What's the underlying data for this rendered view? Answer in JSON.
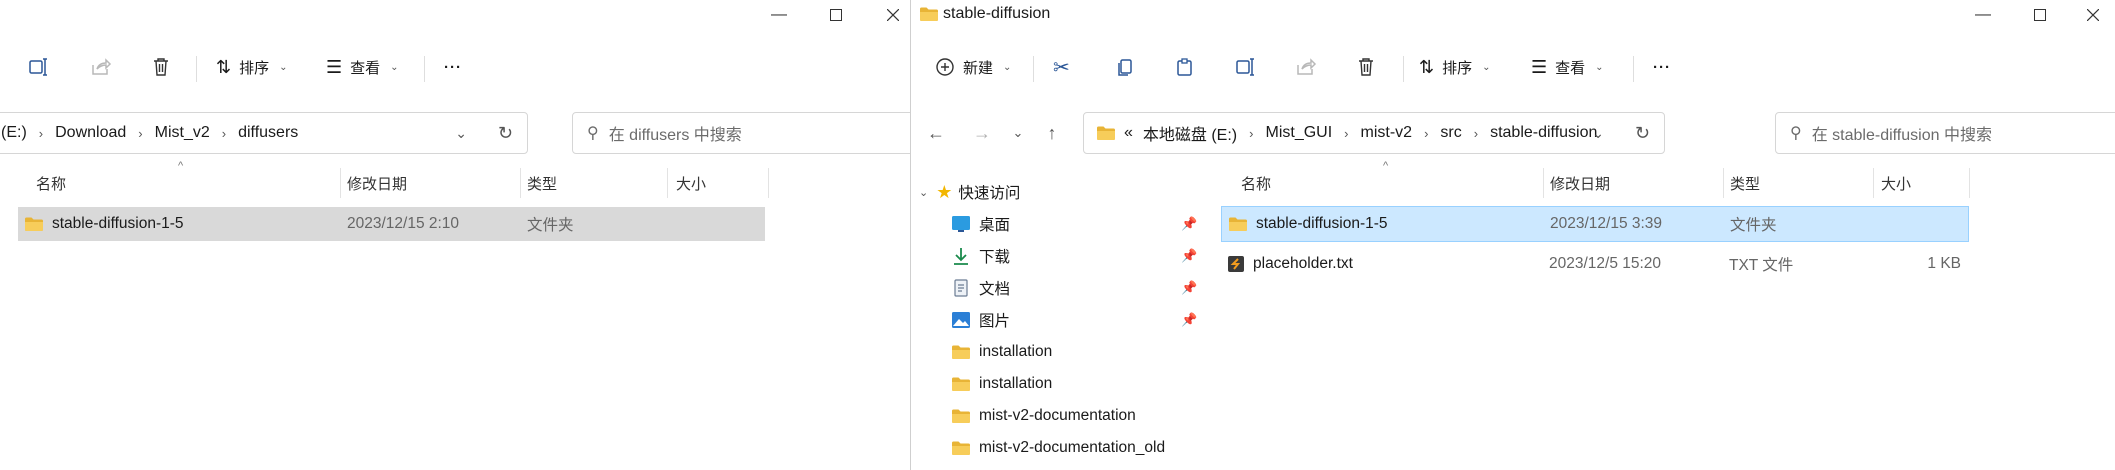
{
  "left_window": {
    "toolbar": {
      "sort_label": "排序",
      "view_label": "查看",
      "more_label": "···"
    },
    "breadcrumb": [
      "(E:)",
      "Download",
      "Mist_v2",
      "diffusers"
    ],
    "search_placeholder": "在 diffusers 中搜索",
    "columns": [
      "名称",
      "修改日期",
      "类型",
      "大小"
    ],
    "rows": [
      {
        "name": "stable-diffusion-1-5",
        "date": "2023/12/15 2:10",
        "type": "文件夹",
        "size": ""
      }
    ]
  },
  "right_window": {
    "title": "stable-diffusion",
    "toolbar": {
      "new_label": "新建",
      "sort_label": "排序",
      "view_label": "查看",
      "more_label": "···"
    },
    "breadcrumb_prefix": "«",
    "breadcrumb": [
      "本地磁盘 (E:)",
      "Mist_GUI",
      "mist-v2",
      "src",
      "stable-diffusion"
    ],
    "search_placeholder": "在 stable-diffusion 中搜索",
    "nav_tree": {
      "quick_access": "快速访问",
      "items": [
        {
          "label": "桌面",
          "icon": "desktop-icon",
          "pinned": true
        },
        {
          "label": "下载",
          "icon": "download-icon",
          "pinned": true
        },
        {
          "label": "文档",
          "icon": "document-icon",
          "pinned": true
        },
        {
          "label": "图片",
          "icon": "picture-icon",
          "pinned": true
        },
        {
          "label": "installation",
          "icon": "folder-icon",
          "pinned": false
        },
        {
          "label": "installation",
          "icon": "folder-icon",
          "pinned": false
        },
        {
          "label": "mist-v2-documentation",
          "icon": "folder-icon",
          "pinned": false
        },
        {
          "label": "mist-v2-documentation_old",
          "icon": "folder-icon",
          "pinned": false
        }
      ]
    },
    "columns": [
      "名称",
      "修改日期",
      "类型",
      "大小"
    ],
    "rows": [
      {
        "name": "stable-diffusion-1-5",
        "date": "2023/12/15 3:39",
        "type": "文件夹",
        "size": "",
        "selected": true
      },
      {
        "name": "placeholder.txt",
        "date": "2023/12/5 15:20",
        "type": "TXT 文件",
        "size": "1 KB",
        "selected": false
      }
    ]
  },
  "colors": {
    "folder": "#f0c24b",
    "selected_row": "#cce8ff",
    "selected_border": "#99d1ff",
    "hover_row": "#d9d9d9",
    "accent": "#0067c0"
  }
}
